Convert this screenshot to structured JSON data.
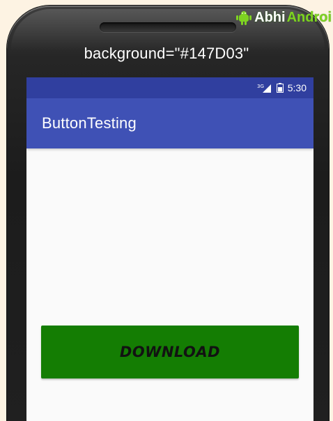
{
  "watermark": {
    "abhi": "Abhi",
    "android": "Androi",
    "icon": "android-robot-icon",
    "color": "#7ed321"
  },
  "caption": "background=\"#147D03\"",
  "status_bar": {
    "network": "3G",
    "icons": [
      "signal-icon",
      "battery-icon"
    ],
    "time": "5:30",
    "color": "#303f9f"
  },
  "app_bar": {
    "title": "ButtonTesting",
    "color": "#3f51b5"
  },
  "main": {
    "button": {
      "label": "DOWNLOAD",
      "background": "#147D03"
    }
  }
}
